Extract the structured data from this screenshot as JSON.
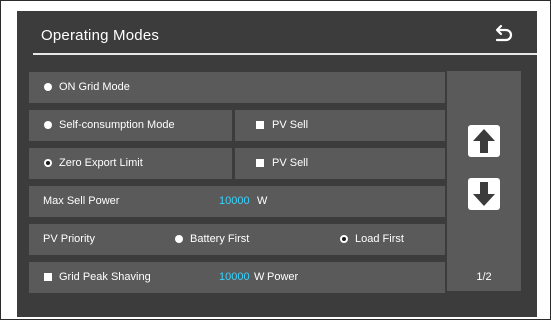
{
  "header": {
    "title": "Operating Modes",
    "back_icon": "return-arrow-icon"
  },
  "rows": {
    "on_grid": {
      "label": "ON Grid Mode",
      "selected": false
    },
    "self_consumption": {
      "label": "Self-consumption Mode",
      "selected": false,
      "pv_sell": "PV Sell"
    },
    "zero_export": {
      "label": "Zero Export Limit",
      "selected": true,
      "pv_sell": "PV Sell"
    },
    "max_sell": {
      "label": "Max Sell Power",
      "value": "10000",
      "unit": "W"
    },
    "pv_priority": {
      "label": "PV Priority",
      "option_battery": "Battery First",
      "option_load": "Load First",
      "selected": "Load First"
    },
    "peak_shaving": {
      "label": "Grid Peak Shaving",
      "value": "10000",
      "unit": "W",
      "suffix": "Power"
    }
  },
  "nav": {
    "page_indicator": "1/2",
    "up_icon": "arrow-up-icon",
    "down_icon": "arrow-down-icon"
  },
  "colors": {
    "background": "#3c3c3c",
    "row": "#5a5a5a",
    "accent": "#36d3ff",
    "text": "#ffffff"
  }
}
